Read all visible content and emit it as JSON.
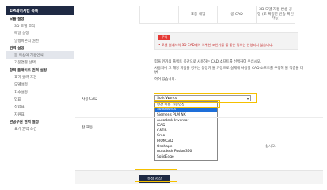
{
  "sidebar": {
    "top_label": "EM제어시킴 목록",
    "items": [
      {
        "label": "모듈 설정",
        "type": "head"
      },
      {
        "label": "3D 모델 조작",
        "type": "sub"
      },
      {
        "label": "매일 설정",
        "type": "sub"
      },
      {
        "label": "발행파본의 권한",
        "type": "sub"
      },
      {
        "label": "권력 설정",
        "type": "head"
      },
      {
        "label": "둘 이상의 가용인식",
        "type": "sub",
        "active": true
      },
      {
        "label": "기문연결 선택",
        "type": "sub"
      },
      {
        "label": "항목 플래이트 권력 설정",
        "type": "head"
      },
      {
        "label": "표기 권력 조건",
        "type": "sub"
      },
      {
        "label": "모델설정",
        "type": "sub"
      },
      {
        "label": "치수설정",
        "type": "sub"
      },
      {
        "label": "입표",
        "type": "sub"
      },
      {
        "label": "정합표",
        "type": "sub"
      },
      {
        "label": "지원표",
        "type": "sub"
      },
      {
        "label": "관공무원 권력 설정",
        "type": "head"
      },
      {
        "label": "표기 권력 조건",
        "type": "sub"
      }
    ]
  },
  "table_strip": {
    "cells": [
      "",
      "표층 체험",
      "공 CAD",
      "3D 모델 자동 반송 공정 (도 확정한 반송 확인 가능)"
    ]
  },
  "notice": {
    "tag": "주의",
    "text": "• 모델 설계사의 3D CAD제어 부위한 포인기를 볼 좋은 정보는 찬영되지 않습니다."
  },
  "description": [
    "힘을 인가의 플렉트 공간으로 사용하는 CAD 소프트를 선택하여 주십시오.",
    "사용되어 그 해당 지정을 경우는 등장가 볼 가장으로 실제에 사용할 CAD 소프트를 추정해 볼 직결을 대변",
    "하여 있습니다."
  ],
  "form": {
    "cad_label": "사용 CAD",
    "second_label": "잡 표등",
    "select_value": "SolidWorks",
    "trailing_text": "십시오."
  },
  "dropdown": {
    "options": [
      "항간 이용 가중인정",
      "SolidWorks",
      "Siemens PLM NX",
      "Autodesk Inventor",
      "iCAD",
      "CATIA",
      "Creo",
      "IRONCAD",
      "Onshape",
      "Autodesk Fusion360",
      "SolidEdge"
    ],
    "selected": "SolidWorks"
  },
  "save": {
    "label": "설정 저장"
  },
  "colors": {
    "navy": "#1f2a44",
    "highlight": "#f5c000",
    "selected": "#1e6fd9",
    "notice": "#e53935"
  }
}
